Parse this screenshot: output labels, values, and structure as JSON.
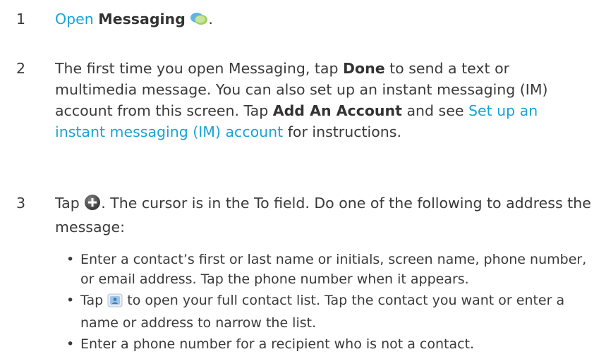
{
  "steps": [
    {
      "number": "1",
      "link": "Open",
      "bold": "Messaging",
      "end": "."
    },
    {
      "number": "2",
      "t1": "The first time you open Messaging, tap ",
      "b1": "Done",
      "t2": " to send a text or multimedia message. You can also set up an instant messaging (IM) account from this screen. Tap ",
      "b2": "Add An Account",
      "t3": " and see ",
      "link": "Set up an instant messaging (IM) account",
      "t4": " for instructions."
    },
    {
      "number": "3",
      "t1": "Tap ",
      "t2": ". The cursor is in the To field. Do one of the following to address the message:"
    }
  ],
  "bullets": [
    {
      "text": "Enter a contact’s first or last name or initials, screen name, phone number, or email address. Tap the phone number when it appears."
    },
    {
      "t1": "Tap ",
      "t2": " to open your full contact list. Tap the contact you want or enter a name or address to narrow the list."
    },
    {
      "text": "Enter a phone number for a recipient who is not a contact."
    }
  ],
  "icons": {
    "messaging": "messaging-app-icon",
    "new": "new-message-icon",
    "contacts": "contacts-icon"
  },
  "colors": {
    "link": "#1aa3d6",
    "text": "#3a3a3a"
  }
}
